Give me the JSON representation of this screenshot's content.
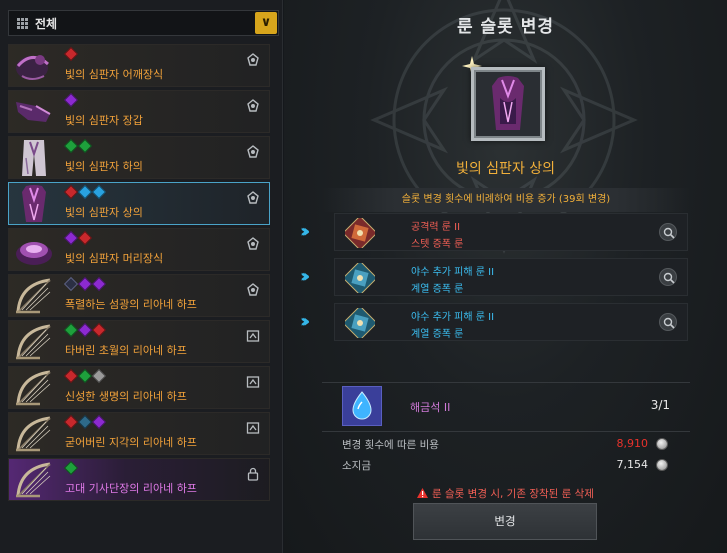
{
  "filter": {
    "label": "전체",
    "icon": "grid-icon",
    "toggle_icon": "chevron-down-icon",
    "accent": "#d7a51c"
  },
  "items": [
    {
      "name": "빛의 심판자 어깨장식",
      "gems": [
        "red"
      ],
      "icon": "rune-type-icon",
      "grade": "relic"
    },
    {
      "name": "빛의 심판자 장갑",
      "gems": [
        "purple"
      ],
      "icon": "rune-type-icon",
      "grade": "relic"
    },
    {
      "name": "빛의 심판자 하의",
      "gems": [
        "green",
        "green"
      ],
      "icon": "rune-type-icon",
      "grade": "relic"
    },
    {
      "name": "빛의 심판자 상의",
      "gems": [
        "red",
        "blue",
        "blue"
      ],
      "icon": "rune-type-icon",
      "grade": "relic",
      "selected": true
    },
    {
      "name": "빛의 심판자 머리장식",
      "gems": [
        "purple",
        "red"
      ],
      "icon": "rune-type-icon",
      "grade": "relic"
    },
    {
      "name": "폭렬하는 섬광의 리아네 하프",
      "gems": [
        "emptyish",
        "purple",
        "purple"
      ],
      "icon": "rune-type-icon",
      "grade": "relic"
    },
    {
      "name": "타버린 초월의 리아네 하프",
      "gems": [
        "green",
        "purple",
        "red"
      ],
      "icon": "weapon-type-icon",
      "grade": "relic"
    },
    {
      "name": "신성한 생명의 리아네 하프",
      "gems": [
        "red",
        "green",
        "gray"
      ],
      "icon": "weapon-type-icon",
      "grade": "relic"
    },
    {
      "name": "굳어버린 지각의 리아네 하프",
      "gems": [
        "red",
        "teal",
        "purple"
      ],
      "icon": "weapon-type-icon",
      "grade": "relic"
    },
    {
      "name": "고대 기사단장의 리아네 하프",
      "gems": [
        "green"
      ],
      "icon": "lock-type-icon",
      "grade": "ancient"
    }
  ],
  "panel": {
    "title": "룬 슬롯 변경",
    "item_name": "빛의 심판자 상의",
    "cost_note": "슬롯 변경 횟수에 비례하여 비용 증가 (39회 변경)",
    "runes": [
      {
        "name": "공격력 룬 II",
        "sub": "스텟 증폭 룬",
        "color": "red",
        "icon": "attack-rune-icon"
      },
      {
        "name": "야수 추가 피해 룬 II",
        "sub": "계열 증폭 룬",
        "color": "blue",
        "icon": "beast-rune-icon"
      },
      {
        "name": "야수 추가 피해 룬 II",
        "sub": "계열 증폭 룬",
        "color": "blue",
        "icon": "beast-rune-icon"
      }
    ],
    "material": {
      "name": "해금석 II",
      "count": "3/1",
      "icon": "unlock-stone-icon"
    },
    "cost": {
      "label": "변경 횟수에 따른 비용",
      "value": "8,910",
      "color": "#e8322c",
      "icon": "silver-coin-icon"
    },
    "owned": {
      "label": "소지금",
      "value": "7,154",
      "color": "#e8e8e8",
      "icon": "silver-coin-icon"
    },
    "warning": "룬 슬롯 변경 시, 기존 장착된 룬 삭제",
    "button": "변경"
  }
}
